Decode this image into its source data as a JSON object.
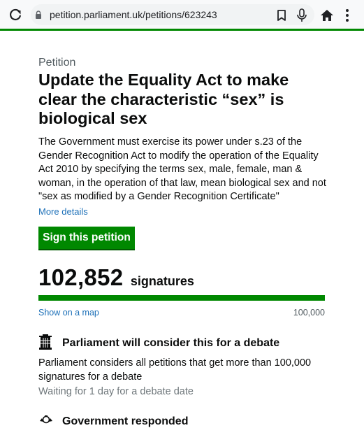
{
  "browser": {
    "url": "petition.parliament.uk/petitions/623243",
    "icons": [
      "reload-icon",
      "lock-icon",
      "bookmark-icon",
      "mic-icon",
      "home-icon",
      "menu-icon"
    ]
  },
  "petition": {
    "eyebrow": "Petition",
    "title": "Update the Equality Act to make clear the characteristic “sex” is biological sex",
    "summary": "The Government must exercise its power under s.23 of the Gender Recognition Act to modify the operation of the Equality Act 2010 by specifying the terms sex, male, female, man & woman, in the operation of that law, mean biological sex and not \"sex as modified by a Gender Recognition Certificate\"",
    "more_details": "More details",
    "sign_button": "Sign this petition"
  },
  "signatures": {
    "count": "102,852",
    "label": "signatures",
    "map_link": "Show on a map",
    "threshold": "100,000",
    "progress_fraction": 1.0
  },
  "debate": {
    "heading": "Parliament will consider this for a debate",
    "text": "Parliament considers all petitions that get more than 100,000 signatures for a debate",
    "status": "Waiting for 1 day for a debate date"
  },
  "government": {
    "heading": "Government responded"
  },
  "colors": {
    "brand_green": "#008800",
    "link_blue": "#1d70b8",
    "text": "#0b0c0c",
    "secondary_text": "#505a5f"
  }
}
